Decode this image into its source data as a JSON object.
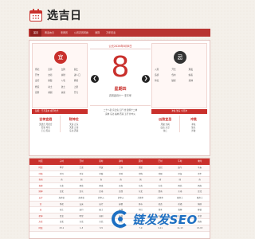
{
  "brand": {
    "title": "选吉日",
    "icon": "calendar-icon"
  },
  "nav": {
    "items": [
      "首页",
      "黄道吉日",
      "老黄历",
      "公历农历转换",
      "测算",
      "万年历表"
    ],
    "active_index": 0
  },
  "main": {
    "yi": {
      "badge": "宜",
      "items": [
        "祭祀",
        "安葬",
        "立碑",
        "谢土",
        "开市",
        "交易",
        "纳财",
        "进人口",
        "出行",
        "嫁娶",
        "入宅",
        "移徙",
        "修造",
        "动土",
        "破土",
        "上梁",
        "冠笄",
        "求嗣",
        "纳采",
        "开光"
      ]
    },
    "yi_bar": "彭祖：壬不汲水 戌不吃犬",
    "left_pair": [
      {
        "title": "吉神宜趋",
        "text": [
          "天德合 月德合",
          "天恩 母仓",
          "王日 天巫"
        ]
      },
      {
        "title": "财神位",
        "text": [
          "天喜 正东",
          "天医 正南",
          "东北 西南"
        ]
      }
    ],
    "date_head": "公元2026年8月8日",
    "big_day": "8",
    "weekday": "星期四",
    "lunar": "农历四月十一 壬午年",
    "shen": [
      "二十八宿 房日兔 五行 金 建除十二神",
      "喜神 东北 福神 西南 五行 炉中火"
    ],
    "ji": {
      "badge": "忌",
      "items": [
        "入殓",
        "开仓",
        "理发",
        "造桥",
        "伐木",
        "纳畜",
        "作灶",
        "破屋",
        "栽种"
      ]
    },
    "ji_bar": "冲兔 煞东 今天冲",
    "right_pair": [
      {
        "title": "凶煞宜忌",
        "text": [
          "月破 大耗",
          "四击 九空",
          "往亡"
        ]
      },
      {
        "title": "冲煞",
        "text": [
          "冲兔",
          "煞东",
          "岁破"
        ]
      }
    ]
  },
  "table": {
    "headers": [
      "时辰",
      "子时",
      "丑时",
      "寅时",
      "卯时",
      "辰时",
      "巳时",
      "午时",
      "未时"
    ],
    "rows": [
      [
        "时辰",
        "甲子",
        "乙丑",
        "丙寅",
        "丁卯",
        "戊辰",
        "己巳",
        "庚午",
        "辛未"
      ],
      [
        "冲煞",
        "冲马",
        "冲羊",
        "冲猴",
        "冲鸡",
        "冲狗",
        "冲猪",
        "冲鼠",
        "冲牛"
      ],
      [
        "吉凶",
        "吉",
        "凶",
        "吉",
        "吉",
        "凶",
        "吉",
        "凶",
        "吉"
      ],
      [
        "喜神",
        "东北",
        "西北",
        "西南",
        "正南",
        "东南",
        "东北",
        "西北",
        "西南"
      ],
      [
        "财神",
        "正北",
        "正东",
        "正南",
        "正西",
        "东北",
        "西南",
        "东南",
        "正北"
      ],
      [
        "五行",
        "海中金",
        "海中金",
        "炉中火",
        "炉中火",
        "大林木",
        "大林木",
        "路旁土",
        "路旁土"
      ],
      [
        "宜",
        "祭祀",
        "安床",
        "出行",
        "嫁娶",
        "开市",
        "修造",
        "祈福",
        "纳财"
      ],
      [
        "忌",
        "动土",
        "出行",
        "破土",
        "安葬",
        "作灶",
        "伐木",
        "栽种",
        "移徙"
      ],
      [
        "星神",
        "青龙",
        "明堂",
        "天刑",
        "朱雀",
        "金匮",
        "天德",
        "白虎",
        "玉堂"
      ],
      [
        "方位",
        "正北",
        "东北",
        "东北",
        "正东",
        "东南",
        "东南",
        "正南",
        "西南"
      ],
      [
        "时段",
        "23-1",
        "1-3",
        "3-5",
        "5-7",
        "7-9",
        "9-11",
        "11-13",
        "13-15"
      ]
    ]
  },
  "watermark": {
    "text": "链发发SEO",
    "icon": "seo-logo-icon"
  },
  "colors": {
    "accent": "#c9302c",
    "nav_bg": "#b83431",
    "nav_active": "#8e1f1d",
    "watermark": "#1d6fc2"
  }
}
